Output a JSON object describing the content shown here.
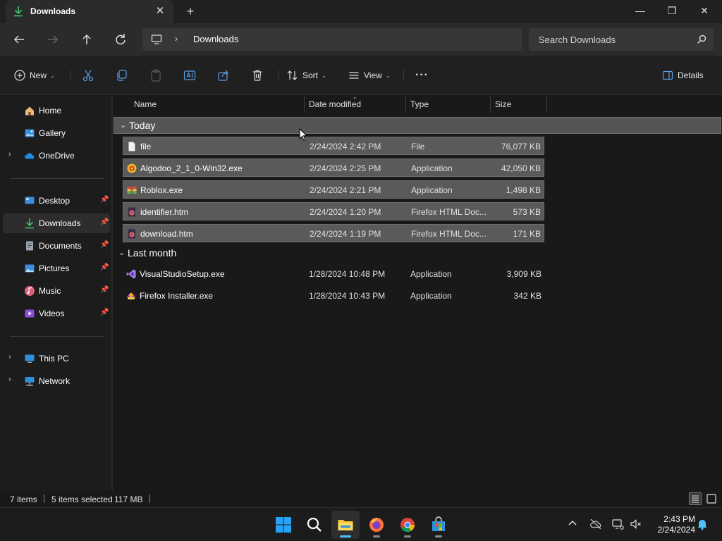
{
  "window": {
    "tab_title": "Downloads",
    "controls": {
      "minimize": "—",
      "maximize": "❐",
      "close": "✕"
    }
  },
  "address": {
    "breadcrumb": [
      "Downloads"
    ],
    "search_placeholder": "Search Downloads"
  },
  "toolbar": {
    "new_label": "New",
    "sort_label": "Sort",
    "view_label": "View",
    "details_label": "Details",
    "more_label": "···"
  },
  "sidebar": {
    "quick": [
      {
        "label": "Home",
        "icon": "home-icon"
      },
      {
        "label": "Gallery",
        "icon": "gallery-icon"
      },
      {
        "label": "OneDrive",
        "icon": "onedrive-icon",
        "expandable": true
      }
    ],
    "pinned": [
      {
        "label": "Desktop",
        "icon": "desktop-icon",
        "pinned": true
      },
      {
        "label": "Downloads",
        "icon": "downloads-icon",
        "pinned": true,
        "selected": true
      },
      {
        "label": "Documents",
        "icon": "documents-icon",
        "pinned": true
      },
      {
        "label": "Pictures",
        "icon": "pictures-icon",
        "pinned": true
      },
      {
        "label": "Music",
        "icon": "music-icon",
        "pinned": true
      },
      {
        "label": "Videos",
        "icon": "videos-icon",
        "pinned": true
      }
    ],
    "locations": [
      {
        "label": "This PC",
        "icon": "this-pc-icon",
        "expandable": true
      },
      {
        "label": "Network",
        "icon": "network-icon",
        "expandable": true
      }
    ]
  },
  "columns": {
    "name": "Name",
    "date": "Date modified",
    "type": "Type",
    "size": "Size"
  },
  "groups": [
    {
      "label": "Today",
      "selected": true,
      "files": [
        {
          "name": "file",
          "date": "2/24/2024 2:42 PM",
          "type": "File",
          "size": "76,077 KB",
          "icon": "blank-file-icon",
          "selected": true
        },
        {
          "name": "Algodoo_2_1_0-Win32.exe",
          "date": "2/24/2024 2:25 PM",
          "type": "Application",
          "size": "42,050 KB",
          "icon": "algodoo-installer-icon",
          "selected": true
        },
        {
          "name": "Roblox.exe",
          "date": "2/24/2024 2:21 PM",
          "type": "Application",
          "size": "1,498 KB",
          "icon": "roblox-installer-icon",
          "selected": true
        },
        {
          "name": "identifier.htm",
          "date": "2/24/2024 1:20 PM",
          "type": "Firefox HTML Doc...",
          "size": "573 KB",
          "icon": "firefox-html-icon",
          "selected": true
        },
        {
          "name": "download.htm",
          "date": "2/24/2024 1:19 PM",
          "type": "Firefox HTML Doc...",
          "size": "171 KB",
          "icon": "firefox-html-icon",
          "selected": true
        }
      ]
    },
    {
      "label": "Last month",
      "selected": false,
      "files": [
        {
          "name": "VisualStudioSetup.exe",
          "date": "1/28/2024 10:48 PM",
          "type": "Application",
          "size": "3,909 KB",
          "icon": "visual-studio-icon",
          "selected": false
        },
        {
          "name": "Firefox Installer.exe",
          "date": "1/28/2024 10:43 PM",
          "type": "Application",
          "size": "342 KB",
          "icon": "firefox-installer-icon",
          "selected": false
        }
      ]
    }
  ],
  "status": {
    "item_count": "7 items",
    "selection": "5 items selected",
    "selection_size": "117 MB"
  },
  "taskbar": {
    "apps": [
      "start-icon",
      "search-icon",
      "file-explorer-icon",
      "firefox-icon",
      "chrome-icon",
      "microsoft-store-icon"
    ],
    "active_app": "file-explorer-icon",
    "clock_time": "2:43 PM",
    "clock_date": "2/24/2024"
  },
  "colors": {
    "accent": "#4cc2ff",
    "selection": "#5a5a5a",
    "background": "#191919"
  }
}
